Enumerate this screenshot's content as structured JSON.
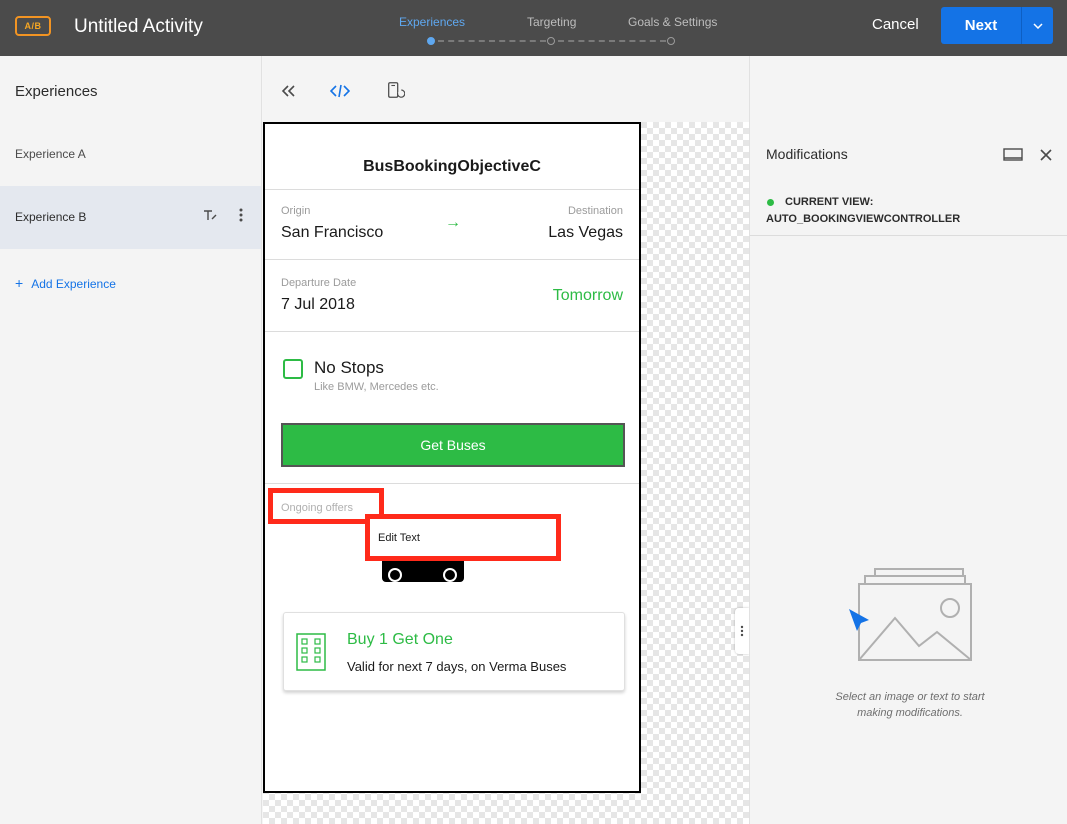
{
  "header": {
    "badge": "A/B",
    "activity_title": "Untitled Activity",
    "steps": [
      {
        "label": "Experiences",
        "active": true
      },
      {
        "label": "Targeting",
        "active": false
      },
      {
        "label": "Goals & Settings",
        "active": false
      }
    ],
    "cancel_label": "Cancel",
    "next_label": "Next"
  },
  "sidebar": {
    "title": "Experiences",
    "items": [
      {
        "label": "Experience A",
        "selected": false
      },
      {
        "label": "Experience B",
        "selected": true
      }
    ],
    "add_label": "Add Experience"
  },
  "toolbar": {
    "icons": [
      "collapse-left-icon",
      "code-icon",
      "device-rotate-icon"
    ]
  },
  "phone": {
    "app_title": "BusBookingObjectiveC",
    "origin_label": "Origin",
    "origin_value": "San Francisco",
    "destination_label": "Destination",
    "destination_value": "Las Vegas",
    "departure_label": "Departure Date",
    "departure_value": "7 Jul 2018",
    "tomorrow_label": "Tomorrow",
    "nostops_label": "No Stops",
    "nostops_sub": "Like BMW, Mercedes etc.",
    "get_buses_label": "Get Buses",
    "offers_label": "Ongoing offers",
    "edit_text_label": "Edit Text",
    "offer_title": "Buy 1 Get One",
    "offer_sub": "Valid for next 7 days, on Verma Buses"
  },
  "modifications": {
    "title": "Modifications",
    "current_view_label": "CURRENT VIEW:",
    "current_view_value": "AUTO_BOOKINGVIEWCONTROLLER",
    "empty_hint": "Select an image or text to start making modifications."
  },
  "colors": {
    "accent_blue": "#1473e6",
    "green": "#2dbb45",
    "highlight_red": "#ff2a1a",
    "topbar": "#4b4b4b"
  }
}
